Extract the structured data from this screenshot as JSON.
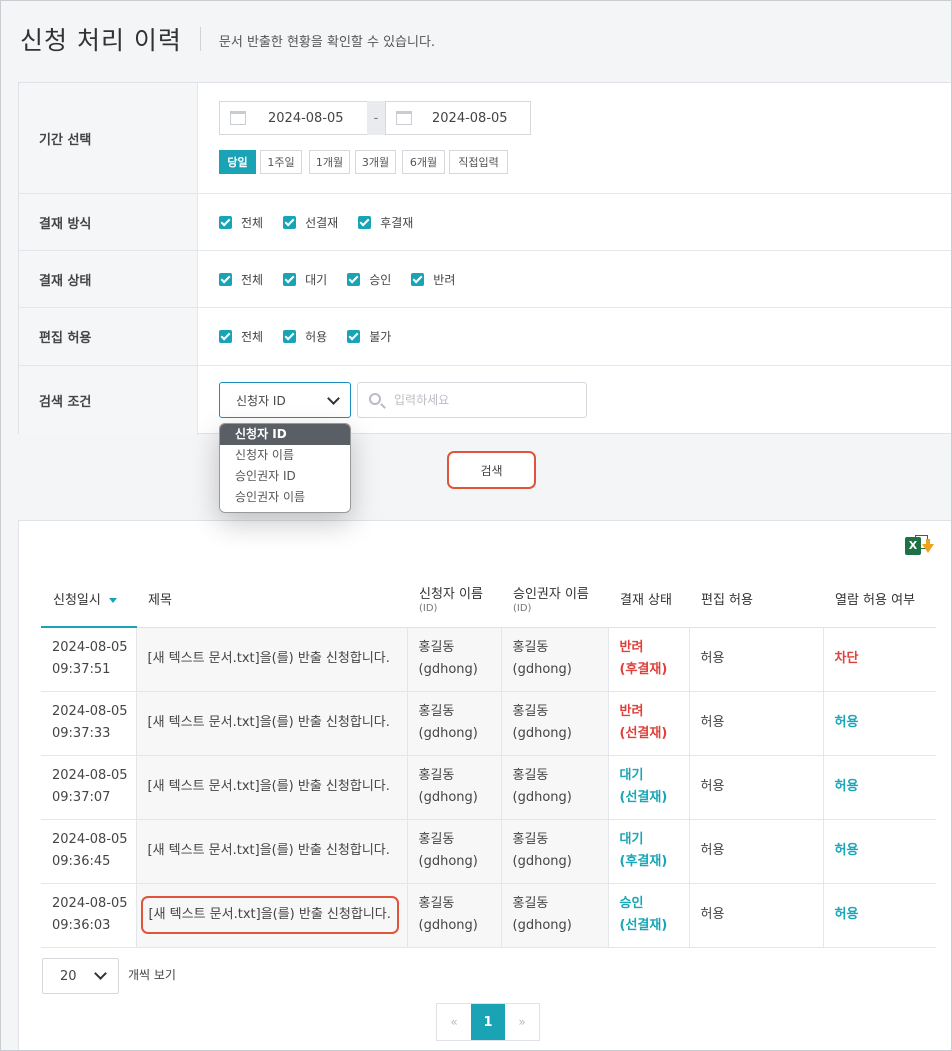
{
  "header": {
    "title": "신청 처리 이력",
    "description": "문서 반출한 현황을 확인할 수 있습니다."
  },
  "filter": {
    "period": {
      "label": "기간 선택",
      "start_date": "2024-08-05",
      "end_date": "2024-08-05",
      "separator": "-",
      "quick_buttons": [
        "당일",
        "1주일",
        "1개월",
        "3개월",
        "6개월",
        "직접입력"
      ],
      "active_quick": "당일"
    },
    "payment_method": {
      "label": "결재 방식",
      "options": [
        "전체",
        "선결재",
        "후결재"
      ]
    },
    "payment_status": {
      "label": "결재 상태",
      "options": [
        "전체",
        "대기",
        "승인",
        "반려"
      ]
    },
    "edit_permission": {
      "label": "편집 허용",
      "options": [
        "전체",
        "허용",
        "불가"
      ]
    },
    "search_condition": {
      "label": "검색 조건",
      "selected": "신청자 ID",
      "placeholder": "입력하세요",
      "options": [
        "신청자 ID",
        "신청자 이름",
        "승인권자 ID",
        "승인권자 이름"
      ]
    },
    "search_button": "검색"
  },
  "results": {
    "excel_icon_letter": "X",
    "columns": [
      {
        "label": "신청일시",
        "sub": ""
      },
      {
        "label": "제목",
        "sub": ""
      },
      {
        "label": "신청자 이름",
        "sub": "(ID)"
      },
      {
        "label": "승인권자 이름",
        "sub": "(ID)"
      },
      {
        "label": "결재 상태",
        "sub": ""
      },
      {
        "label": "편집 허용",
        "sub": ""
      },
      {
        "label": "열람 허용 여부",
        "sub": ""
      }
    ],
    "rows": [
      {
        "date": "2024-08-05",
        "time": "09:37:51",
        "title": "[새 텍스트 문서.txt]을(를) 반출 신청합니다.",
        "applicant_name": "홍길동",
        "applicant_id": "(gdhong)",
        "approver_name": "홍길동",
        "approver_id": "(gdhong)",
        "status": "반려",
        "method": "(후결재)",
        "edit": "허용",
        "view": "차단"
      },
      {
        "date": "2024-08-05",
        "time": "09:37:33",
        "title": "[새 텍스트 문서.txt]을(를) 반출 신청합니다.",
        "applicant_name": "홍길동",
        "applicant_id": "(gdhong)",
        "approver_name": "홍길동",
        "approver_id": "(gdhong)",
        "status": "반려",
        "method": "(선결재)",
        "edit": "허용",
        "view": "허용"
      },
      {
        "date": "2024-08-05",
        "time": "09:37:07",
        "title": "[새 텍스트 문서.txt]을(를) 반출 신청합니다.",
        "applicant_name": "홍길동",
        "applicant_id": "(gdhong)",
        "approver_name": "홍길동",
        "approver_id": "(gdhong)",
        "status": "대기",
        "method": "(선결재)",
        "edit": "허용",
        "view": "허용"
      },
      {
        "date": "2024-08-05",
        "time": "09:36:45",
        "title": "[새 텍스트 문서.txt]을(를) 반출 신청합니다.",
        "applicant_name": "홍길동",
        "applicant_id": "(gdhong)",
        "approver_name": "홍길동",
        "approver_id": "(gdhong)",
        "status": "대기",
        "method": "(후결재)",
        "edit": "허용",
        "view": "허용"
      },
      {
        "date": "2024-08-05",
        "time": "09:36:03",
        "title": "[새 텍스트 문서.txt]을(를) 반출 신청합니다.",
        "applicant_name": "홍길동",
        "applicant_id": "(gdhong)",
        "approver_name": "홍길동",
        "approver_id": "(gdhong)",
        "status": "승인",
        "method": "(선결재)",
        "edit": "허용",
        "view": "허용"
      }
    ],
    "page_size": "20",
    "page_size_label": "개씩 보기",
    "pagination": {
      "prev": "«",
      "current": "1",
      "next": "»"
    }
  },
  "colors": {
    "accent": "#1aa3b5",
    "danger": "#e0413a",
    "highlight": "#e0553a"
  }
}
